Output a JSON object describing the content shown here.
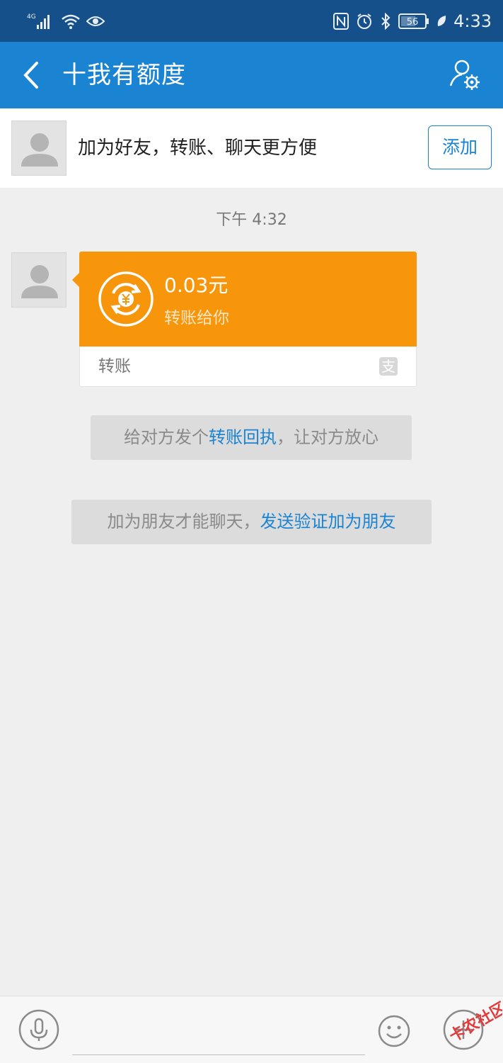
{
  "status_bar": {
    "network": "4G",
    "battery": "56",
    "time": "4:33"
  },
  "nav": {
    "title": "十我有额度"
  },
  "friend_bar": {
    "text": "加为好友，转账、聊天更方便",
    "add_label": "添加"
  },
  "chat": {
    "timestamp": "下午 4:32",
    "transfer_card": {
      "amount": "0.03元",
      "description": "转账给你",
      "footer_label": "转账",
      "footer_badge": "支"
    },
    "system_messages": [
      {
        "prefix": "给对方发个",
        "link": "转账回执",
        "suffix": "，让对方放心"
      },
      {
        "prefix": "加为朋友才能聊天，",
        "link": "发送验证加为朋友",
        "suffix": ""
      }
    ]
  },
  "input_bar": {
    "placeholder": ""
  },
  "watermark": {
    "text": "卡农社区"
  },
  "colors": {
    "status_bar": "#15508a",
    "nav_bar": "#1b84d2",
    "transfer_orange": "#f7960b",
    "link_blue": "#1b84d2",
    "background": "#efefef"
  },
  "icons": [
    "signal-icon",
    "wifi-icon",
    "eye-icon",
    "nfc-icon",
    "alarm-icon",
    "bluetooth-icon",
    "battery-icon",
    "leaf-icon",
    "back-icon",
    "user-settings-icon",
    "avatar-icon",
    "transfer-coin-icon",
    "alipay-icon",
    "mic-icon",
    "emoji-icon",
    "plus-icon"
  ]
}
